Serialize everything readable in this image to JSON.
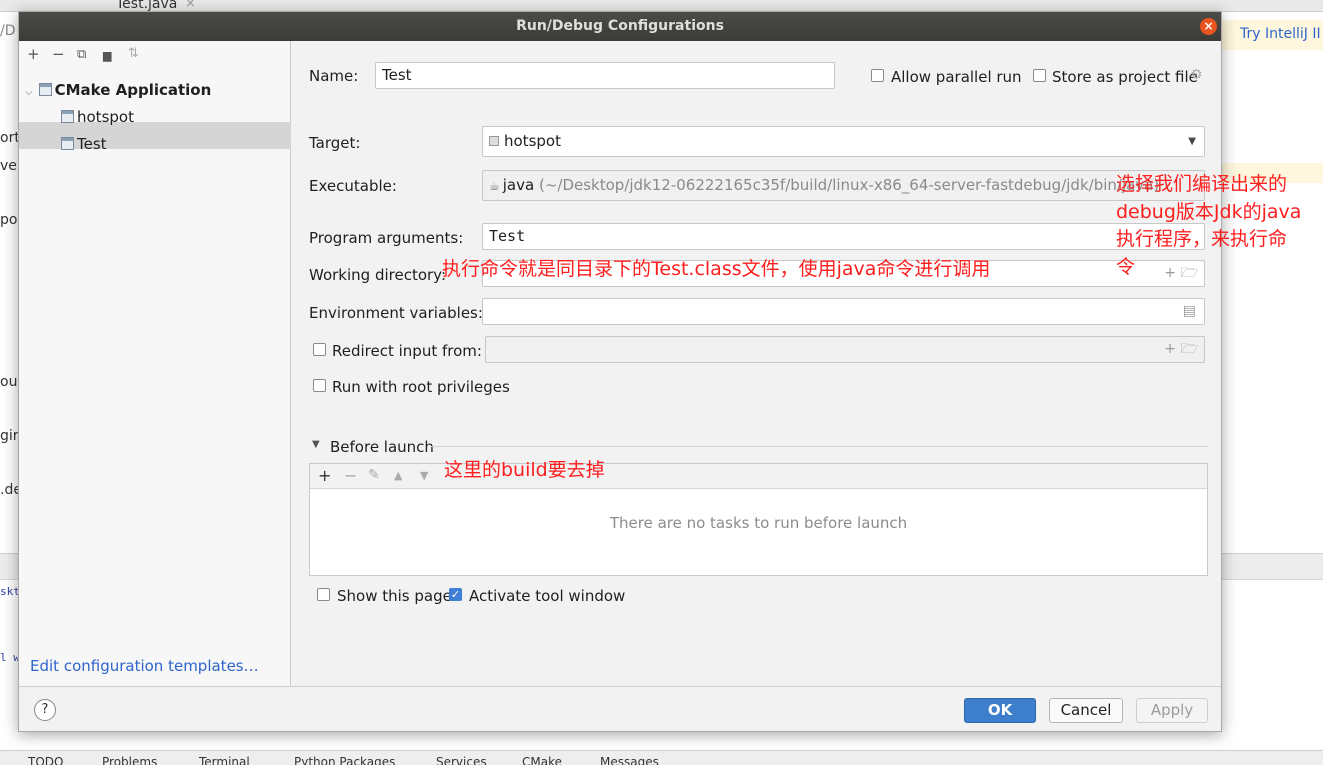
{
  "background": {
    "tab_title": "Test.java",
    "tab_close": "×",
    "path_fragment": "/D",
    "try_intellij": "Try IntelliJ II",
    "side_fragments": [
      "ort",
      "ver",
      "po",
      "oug",
      "gir",
      ".de",
      "skt",
      "l w"
    ]
  },
  "dialog": {
    "title": "Run/Debug Configurations",
    "close_glyph": "×"
  },
  "toolbar": {
    "add": "+",
    "remove": "−",
    "copy": "⧉",
    "folder": "▆",
    "sort": "⇅"
  },
  "tree": {
    "group_label": "CMake Application",
    "items": [
      {
        "label": "hotspot"
      },
      {
        "label": "Test"
      }
    ]
  },
  "edit_templates_link": "Edit configuration templates…",
  "help_glyph": "?",
  "form": {
    "name_label": "Name:",
    "name_value": "Test",
    "allow_parallel_label": "Allow parallel run",
    "store_project_label": "Store as project file",
    "target_label": "Target:",
    "target_value": "hotspot",
    "executable_label": "Executable:",
    "executable_name": "java",
    "executable_path": "(~/Desktop/jdk12-06222165c35f/build/linux-x86_64-server-fastdebug/jdk/bin/java)",
    "program_args_label": "Program arguments:",
    "program_args_value": "Test",
    "working_dir_label": "Working directory:",
    "env_vars_label": "Environment variables:",
    "redirect_label": "Redirect input from:",
    "root_priv_label": "Run with root privileges"
  },
  "before_launch": {
    "header": "Before launch",
    "empty_text": "There are no tasks to run before launch"
  },
  "options": {
    "show_page_label": "Show this page",
    "show_page_checked": false,
    "activate_tool_label": "Activate tool window",
    "activate_tool_checked": true
  },
  "buttons": {
    "ok": "OK",
    "cancel": "Cancel",
    "apply": "Apply"
  },
  "annotations": {
    "executable_note": [
      "选择我们编译出来的",
      "debug版本Jdk的java",
      "执行程序，来执行命",
      "令"
    ],
    "args_note": "执行命令就是同目录下的Test.class文件，使用java命令进行调用",
    "build_note": "这里的build要去掉"
  },
  "bottom_tabs": [
    "TODO",
    "Problems",
    "Terminal",
    "Python Packages",
    "Services",
    "CMake",
    "Messages"
  ],
  "colors": {
    "accent": "#3d7fcc",
    "annotation": "#ff1e1e",
    "link": "#2f65ca",
    "close": "#e95420"
  }
}
